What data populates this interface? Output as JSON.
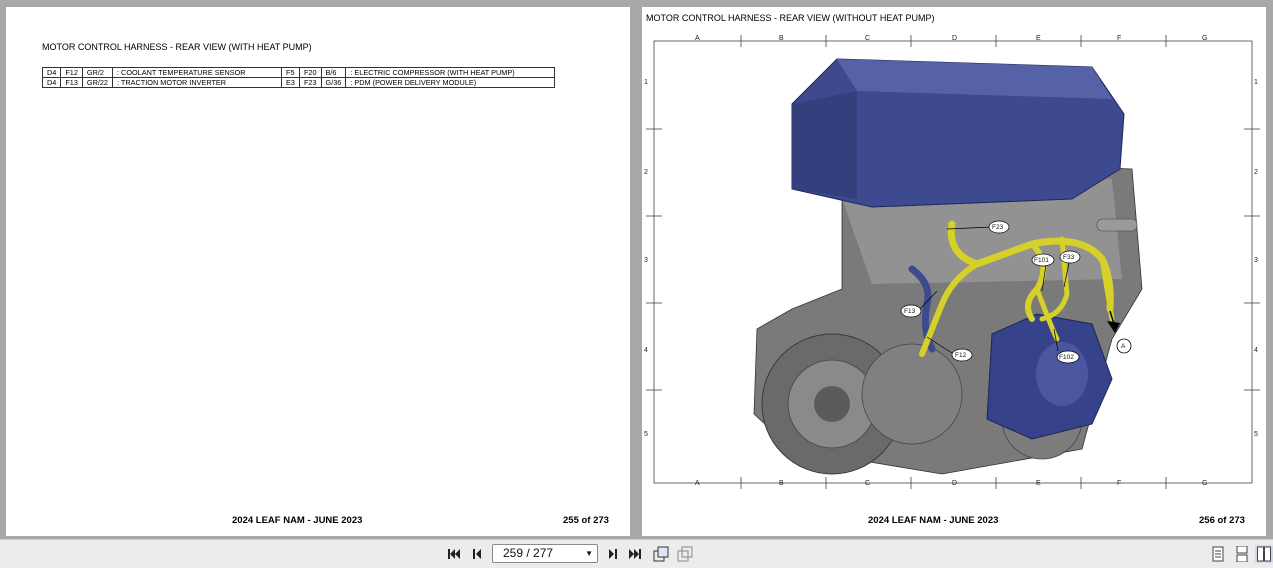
{
  "left_page": {
    "title": "MOTOR CONTROL HARNESS - REAR VIEW (WITH HEAT PUMP)",
    "connectors": [
      [
        "D4",
        "F12",
        "GR/2",
        ": COOLANT TEMPERATURE SENSOR",
        "F5",
        "F20",
        "B/6",
        ": ELECTRIC COMPRESSOR (WITH HEAT PUMP)"
      ],
      [
        "D4",
        "F13",
        "GR/22",
        ": TRACTION MOTOR INVERTER",
        "E3",
        "F23",
        "G/36",
        ": PDM (POWER DELIVERY MODULE)"
      ]
    ],
    "footer_title": "2024 LEAF NAM - JUNE 2023",
    "footer_page": "255 of 273"
  },
  "right_page": {
    "title": "MOTOR CONTROL HARNESS - REAR VIEW (WITHOUT HEAT PUMP)",
    "grid_cols": [
      "A",
      "B",
      "C",
      "D",
      "E",
      "F",
      "G"
    ],
    "grid_rows": [
      "1",
      "2",
      "3",
      "4",
      "5"
    ],
    "callouts": {
      "f23": "F23",
      "f101": "F101",
      "f33": "F33",
      "f13": "F13",
      "f12": "F12",
      "f102": "F102",
      "a": "A"
    },
    "footer_title": "2024 LEAF NAM - JUNE 2023",
    "footer_page": "256 of 273"
  },
  "toolbar": {
    "page_indicator": "259 / 277",
    "icons": [
      "first-page-icon",
      "prev-page-icon",
      "next-page-icon",
      "last-page-icon",
      "rotate-icon",
      "copy-icon",
      "single-page-icon",
      "continuous-icon",
      "two-page-icon"
    ]
  }
}
